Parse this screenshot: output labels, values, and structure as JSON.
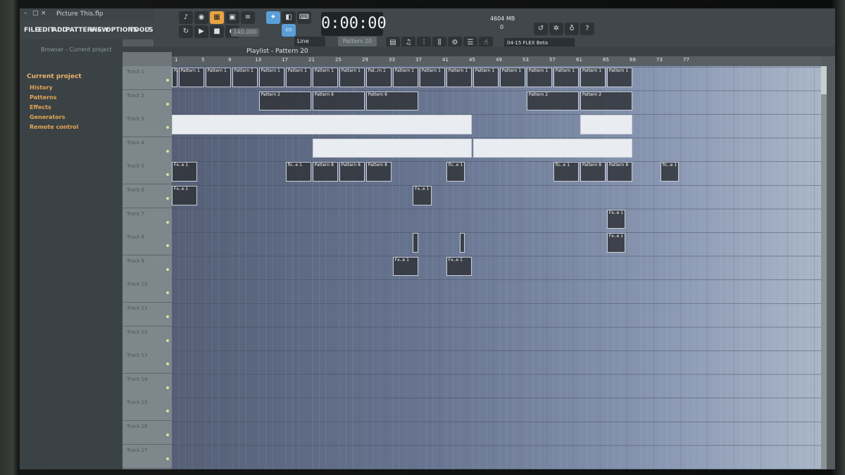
{
  "window": {
    "title": "Picture This.flp"
  },
  "menu": {
    "items": [
      "FILE",
      "EDIT",
      "ADD",
      "PATTERNS",
      "VIEW",
      "OPTIONS",
      "TOOLS",
      "?"
    ]
  },
  "transport": {
    "time": "0:00:00",
    "tempo": "140.000",
    "pattern": "Pattern 20",
    "snap": "Line"
  },
  "status": {
    "cpu_line1": "4604 MB",
    "cpu_line2": "0"
  },
  "news": {
    "text": "04-15  FLEX Beta"
  },
  "browser": {
    "header": "Browser - Current project",
    "items": [
      {
        "label": "Current project",
        "top": true
      },
      {
        "label": "History"
      },
      {
        "label": "Patterns"
      },
      {
        "label": "Effects"
      },
      {
        "label": "Generators"
      },
      {
        "label": "Remote control"
      }
    ]
  },
  "playlist": {
    "title": "Playlist - Pattern 20",
    "ruler": [
      "1",
      "5",
      "9",
      "13",
      "17",
      "21",
      "25",
      "29",
      "33",
      "37",
      "41",
      "45",
      "49",
      "53",
      "57",
      "61",
      "65",
      "69",
      "73",
      "77"
    ],
    "tracks": [
      "Track 1",
      "Track 2",
      "Track 3",
      "Track 4",
      "Track 5",
      "Track 6",
      "Track 7",
      "Track 8",
      "Track 9",
      "Track 10",
      "Track 11",
      "Track 12",
      "Track 13",
      "Track 14",
      "Track 15",
      "Track 16",
      "Track 17"
    ],
    "clip_labels": {
      "pattern1": "Pattern 1",
      "pattern2": "Pattern 2",
      "pattern6": "Pattern 6",
      "pattern8": "Pattern 8",
      "pattern_short": "Pat..rn 1",
      "pattern_start": "P..16..3",
      "fx": "fic..e 1",
      "audio": "Fx..e 1"
    }
  }
}
